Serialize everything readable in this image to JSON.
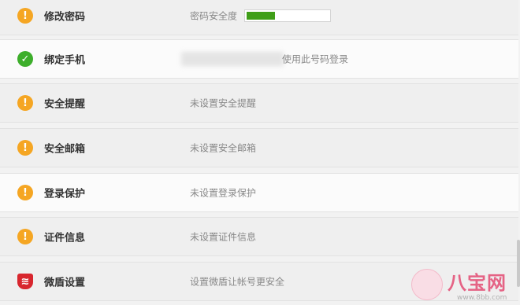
{
  "rows": [
    {
      "title": "修改密码",
      "desc": "密码安全度",
      "status": "warning",
      "strength": 0.35
    },
    {
      "title": "绑定手机",
      "desc": "使用此号码登录",
      "status": "ok"
    },
    {
      "title": "安全提醒",
      "desc": "未设置安全提醒",
      "status": "warning"
    },
    {
      "title": "安全邮箱",
      "desc": "未设置安全邮箱",
      "status": "warning"
    },
    {
      "title": "登录保护",
      "desc": "未设置登录保护",
      "status": "warning"
    },
    {
      "title": "证件信息",
      "desc": "未设置证件信息",
      "status": "warning"
    },
    {
      "title": "微盾设置",
      "desc": "设置微盾让帐号更安全",
      "status": "shield"
    }
  ],
  "icons": {
    "warning": "exclamation-icon",
    "ok": "check-icon",
    "shield": "shield-icon"
  },
  "colors": {
    "warning": "#f5a623",
    "ok": "#3dae2b",
    "shield": "#d8262e",
    "strength_fill": "#3f9e18"
  },
  "watermark": {
    "text": "八宝网",
    "url": "www.8bb.com"
  }
}
